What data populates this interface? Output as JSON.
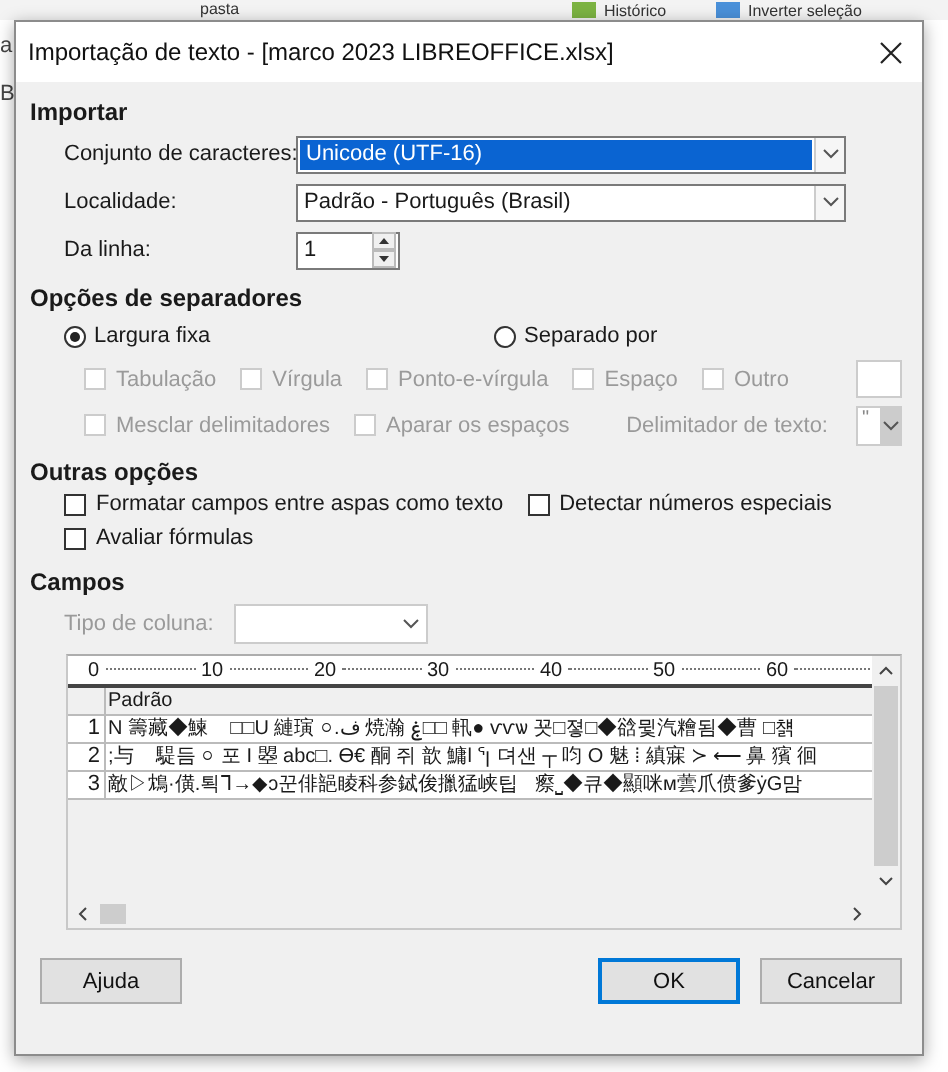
{
  "background": {
    "toolbar_items": [
      "pasta",
      "Histórico",
      "Inverter seleção"
    ],
    "edge_letters": [
      "a",
      "B"
    ]
  },
  "window": {
    "title": "Importação de texto - [marco 2023 LIBREOFFICE.xlsx]"
  },
  "import": {
    "heading": "Importar",
    "fields": [
      {
        "kind": "select",
        "label": "Conjunto de caracteres:",
        "value": "Unicode (UTF-16)",
        "highlighted": true
      },
      {
        "kind": "select",
        "label": "Localidade:",
        "value": "Padrão - Português (Brasil)",
        "highlighted": false
      },
      {
        "kind": "spin",
        "label": "Da linha:",
        "value": "1"
      }
    ]
  },
  "separator_options": {
    "heading": "Opções de separadores",
    "modes": [
      {
        "label": "Largura fixa",
        "selected": true
      },
      {
        "label": "Separado por",
        "selected": false
      }
    ],
    "separators": [
      {
        "label": "Tabulação",
        "checked": false,
        "disabled": true
      },
      {
        "label": "Vírgula",
        "checked": false,
        "disabled": true
      },
      {
        "label": "Ponto-e-vírgula",
        "checked": false,
        "disabled": true
      },
      {
        "label": "Espaço",
        "checked": false,
        "disabled": true
      },
      {
        "label": "Outro",
        "checked": false,
        "disabled": true
      }
    ],
    "extras": [
      {
        "label": "Mesclar delimitadores",
        "checked": false,
        "disabled": true
      },
      {
        "label": "Aparar os espaços",
        "checked": false,
        "disabled": true
      }
    ],
    "text_delimiter": {
      "label": "Delimitador de texto:",
      "value": "\"",
      "disabled": true
    }
  },
  "other_options": {
    "heading": "Outras opções",
    "options": [
      {
        "label": "Formatar campos entre aspas como texto",
        "checked": false
      },
      {
        "label": "Detectar números especiais",
        "checked": false
      },
      {
        "label": "Avaliar fórmulas",
        "checked": false
      }
    ]
  },
  "fields": {
    "heading": "Campos",
    "column_type": {
      "label": "Tipo de coluna:",
      "disabled": true
    },
    "ruler": [
      "0",
      "10",
      "20",
      "30",
      "40",
      "50",
      "60"
    ],
    "column_header": "Padrão",
    "rows": [
      {
        "number": "1",
        "text": "N 籌藏◆鰊    □□U 縺璌 ০.ف 焼瀚 ۼ□□ 軐● ѵѵѡ 꾯□졓□◆谽뮟汽糩됨◆曹 □첅"
      },
      {
        "number": "2",
        "text": ";与    騠듬 ০ 포 I 曌 abc□. ϴ€ 酮 쥐 歆 鱅l ᕐꞁ 뎌샌 ┬ 呁 Ο 魅 ⁞ 縝寐 ≻ ⟵ 鼻 獱 徊"
      },
      {
        "number": "3",
        "text": "敵▷鴆·僙.퇵ᒣ→◆ɔ꾼俳郶睖科参鋱㑓擸猛峡팁   瘵⎵◆큐◆顯咪м蕓爪偾爹ẏG맘"
      }
    ]
  },
  "buttons": [
    {
      "label": "Ajuda",
      "default": false
    },
    {
      "label": "OK",
      "default": true
    },
    {
      "label": "Cancelar",
      "default": false
    }
  ]
}
